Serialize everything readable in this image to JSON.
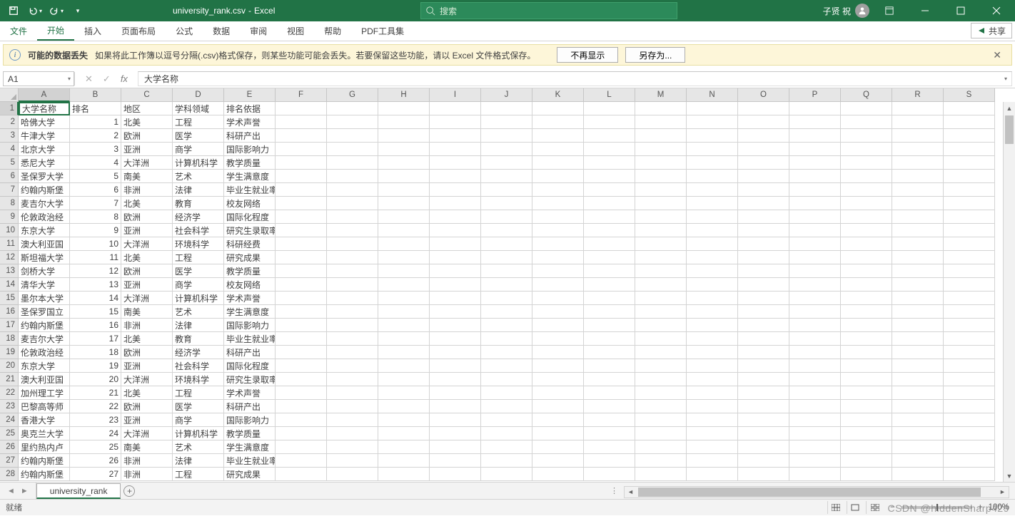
{
  "title": {
    "filename": "university_rank.csv",
    "app": "Excel"
  },
  "search_placeholder": "搜索",
  "user_name": "子贤 祝",
  "ribbon_tabs": [
    "文件",
    "开始",
    "插入",
    "页面布局",
    "公式",
    "数据",
    "审阅",
    "视图",
    "帮助",
    "PDF工具集"
  ],
  "share_label": "共享",
  "infobar": {
    "title": "可能的数据丢失",
    "msg": "如果将此工作簿以逗号分隔(.csv)格式保存，则某些功能可能会丢失。若要保留这些功能，请以 Excel 文件格式保存。",
    "btn_dismiss": "不再显示",
    "btn_saveas": "另存为..."
  },
  "namebox": "A1",
  "formula_bar_value": "大学名称",
  "columns": [
    "A",
    "B",
    "C",
    "D",
    "E",
    "F",
    "G",
    "H",
    "I",
    "J",
    "K",
    "L",
    "M",
    "N",
    "O",
    "P",
    "Q",
    "R",
    "S"
  ],
  "row_count": 28,
  "selected_cell": {
    "row": 1,
    "col": 1
  },
  "table": {
    "headers": [
      "大学名称",
      "排名",
      "地区",
      "学科领域",
      "排名依据"
    ],
    "rows": [
      [
        "哈佛大学",
        "1",
        "北美",
        "工程",
        "学术声誉"
      ],
      [
        "牛津大学",
        "2",
        "欧洲",
        "医学",
        "科研产出"
      ],
      [
        "北京大学",
        "3",
        "亚洲",
        "商学",
        "国际影响力"
      ],
      [
        "悉尼大学",
        "4",
        "大洋洲",
        "计算机科学",
        "教学质量"
      ],
      [
        "圣保罗大学",
        "5",
        "南美",
        "艺术",
        "学生满意度"
      ],
      [
        "约翰内斯堡",
        "6",
        "非洲",
        "法律",
        "毕业生就业率"
      ],
      [
        "麦吉尔大学",
        "7",
        "北美",
        "教育",
        "校友网络"
      ],
      [
        "伦敦政治经",
        "8",
        "欧洲",
        "经济学",
        "国际化程度"
      ],
      [
        "东京大学",
        "9",
        "亚洲",
        "社会科学",
        "研究生录取率"
      ],
      [
        "澳大利亚国",
        "10",
        "大洋洲",
        "环境科学",
        "科研经费"
      ],
      [
        "斯坦福大学",
        "11",
        "北美",
        "工程",
        "研究成果"
      ],
      [
        "剑桥大学",
        "12",
        "欧洲",
        "医学",
        "教学质量"
      ],
      [
        "清华大学",
        "13",
        "亚洲",
        "商学",
        "校友网络"
      ],
      [
        "墨尔本大学",
        "14",
        "大洋洲",
        "计算机科学",
        "学术声誉"
      ],
      [
        "圣保罗国立",
        "15",
        "南美",
        "艺术",
        "学生满意度"
      ],
      [
        "约翰内斯堡",
        "16",
        "非洲",
        "法律",
        "国际影响力"
      ],
      [
        "麦吉尔大学",
        "17",
        "北美",
        "教育",
        "毕业生就业率"
      ],
      [
        "伦敦政治经",
        "18",
        "欧洲",
        "经济学",
        "科研产出"
      ],
      [
        "东京大学",
        "19",
        "亚洲",
        "社会科学",
        "国际化程度"
      ],
      [
        "澳大利亚国",
        "20",
        "大洋洲",
        "环境科学",
        "研究生录取率"
      ],
      [
        "加州理工学",
        "21",
        "北美",
        "工程",
        "学术声誉"
      ],
      [
        "巴黎高等师",
        "22",
        "欧洲",
        "医学",
        "科研产出"
      ],
      [
        "香港大学",
        "23",
        "亚洲",
        "商学",
        "国际影响力"
      ],
      [
        "奥克兰大学",
        "24",
        "大洋洲",
        "计算机科学",
        "教学质量"
      ],
      [
        "里约热内卢",
        "25",
        "南美",
        "艺术",
        "学生满意度"
      ],
      [
        "约翰内斯堡",
        "26",
        "非洲",
        "法律",
        "毕业生就业率"
      ],
      [
        "约翰内斯堡",
        "27",
        "非洲",
        "工程",
        "研究成果"
      ]
    ]
  },
  "sheet_tab": "university_rank",
  "status_text": "就绪",
  "zoom_value": "100%",
  "watermark": "CSDN @hiddenSharp429"
}
